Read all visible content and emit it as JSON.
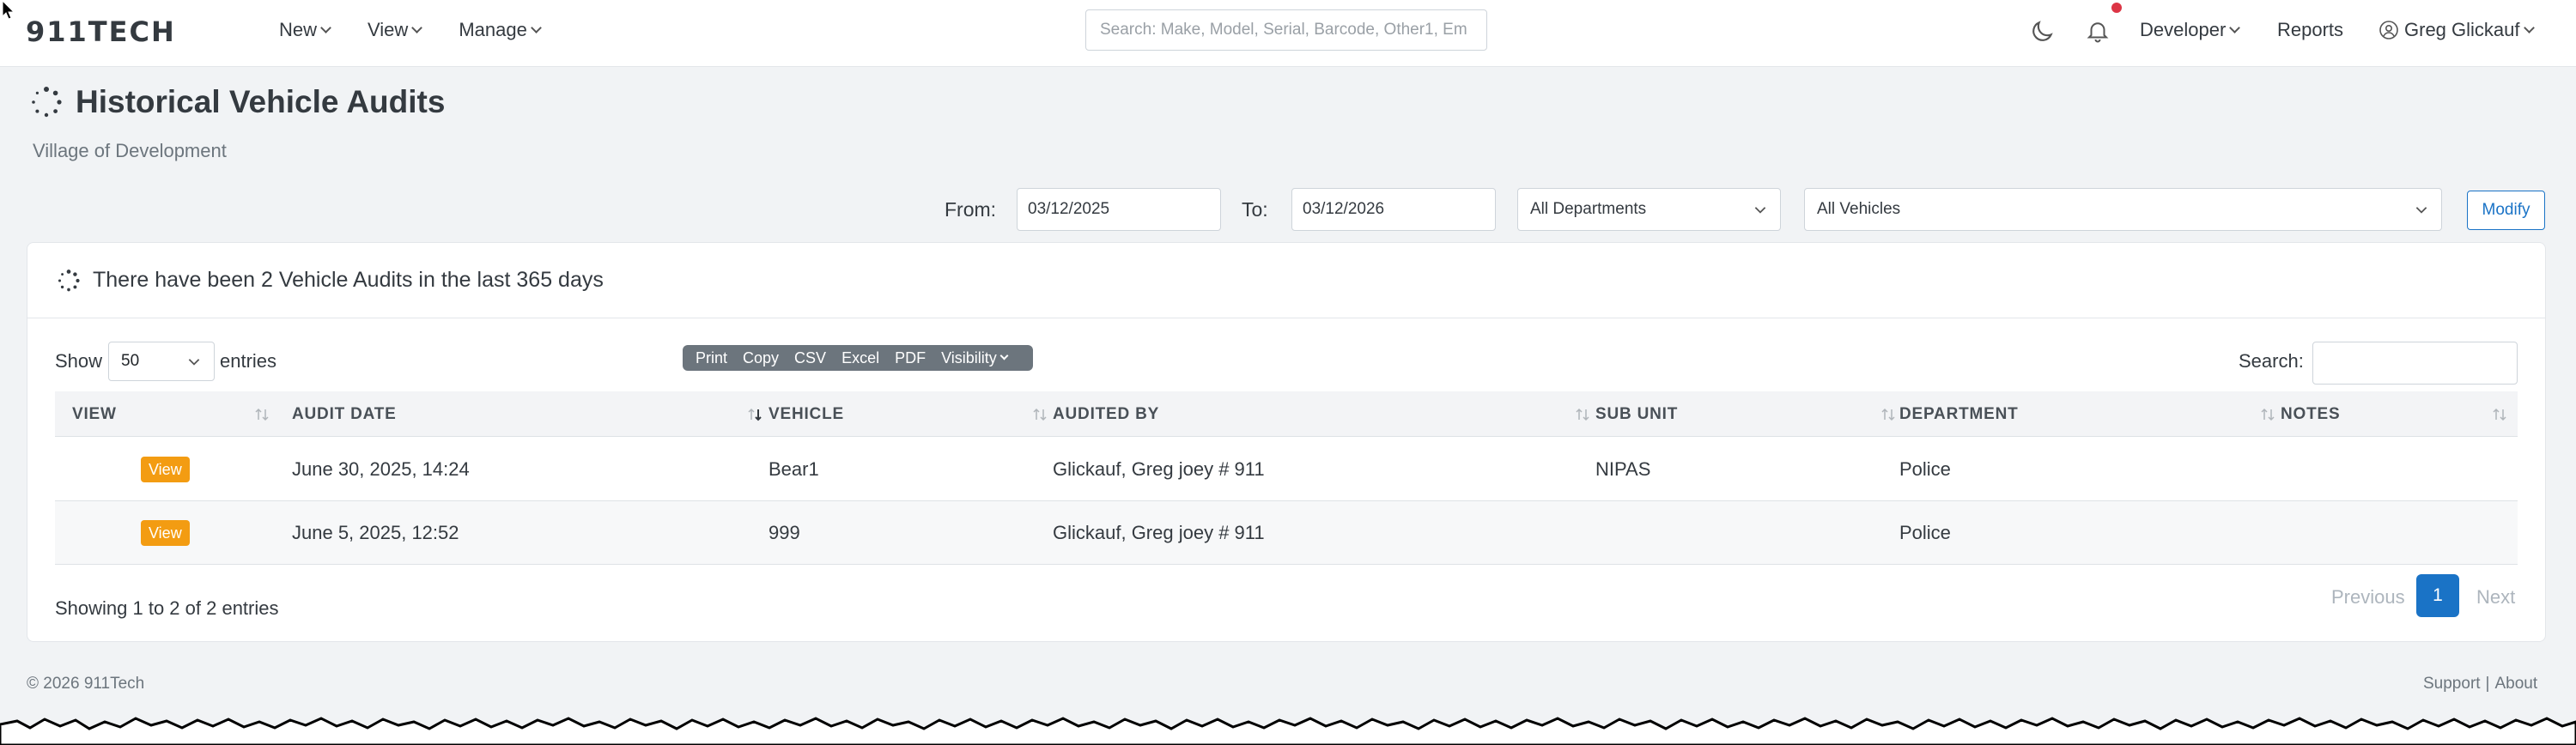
{
  "navbar": {
    "logo": "911TECH",
    "menu": [
      {
        "label": "New"
      },
      {
        "label": "View"
      },
      {
        "label": "Manage"
      }
    ],
    "search_placeholder": "Search: Make, Model, Serial, Barcode, Other1, Em",
    "developer_label": "Developer",
    "reports_label": "Reports",
    "user_label": "Greg Glickauf",
    "notification_dot_color": "#dc3545"
  },
  "page": {
    "title": "Historical Vehicle Audits",
    "subtitle": "Village of Development"
  },
  "filters": {
    "from_label": "From:",
    "from_value": "03/12/2025",
    "to_label": "To:",
    "to_value": "03/12/2026",
    "department_value": "All Departments",
    "vehicle_value": "All Vehicles",
    "modify_label": "Modify"
  },
  "card": {
    "title": "There have been 2 Vehicle Audits in the last 365 days",
    "show_label": "Show",
    "entries_value": "50",
    "entries_label": "entries",
    "export_buttons": [
      "Print",
      "Copy",
      "CSV",
      "Excel",
      "PDF",
      "Visibility"
    ],
    "search_label": "Search:",
    "columns": [
      "VIEW",
      "AUDIT DATE",
      "VEHICLE",
      "AUDITED BY",
      "SUB UNIT",
      "DEPARTMENT",
      "NOTES"
    ],
    "rows": [
      {
        "view": "View",
        "audit_date": "June 30, 2025, 14:24",
        "vehicle": "Bear1",
        "audited_by": "Glickauf, Greg joey # 911",
        "sub_unit": "NIPAS",
        "department": "Police",
        "notes": ""
      },
      {
        "view": "View",
        "audit_date": "June 5, 2025, 12:52",
        "vehicle": "999",
        "audited_by": "Glickauf, Greg joey # 911",
        "sub_unit": "",
        "department": "Police",
        "notes": ""
      }
    ],
    "showing": "Showing 1 to 2 of 2 entries",
    "pager_previous": "Previous",
    "pager_current": "1",
    "pager_next": "Next"
  },
  "footer": {
    "copyright": "© 2026 911Tech",
    "support": "Support",
    "separator": "|",
    "about": "About"
  },
  "colors": {
    "accent": "#1a73c6",
    "view_button": "#f39c12",
    "export_group": "#6c757d"
  }
}
